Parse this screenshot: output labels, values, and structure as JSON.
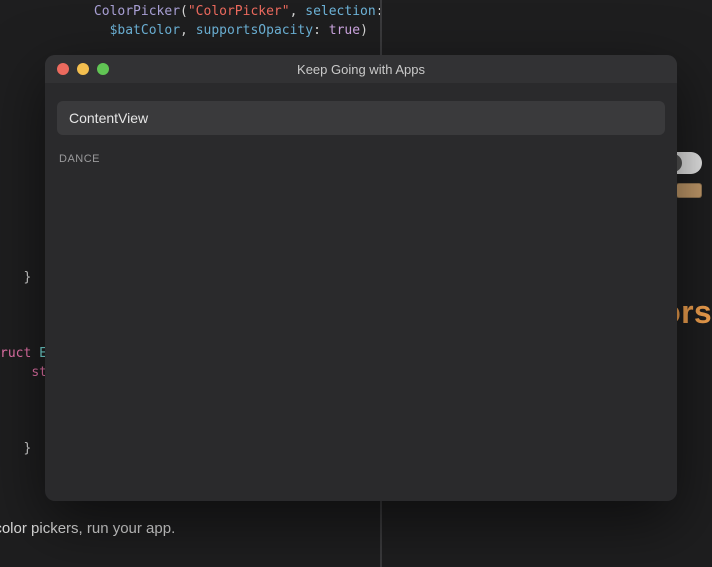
{
  "code": {
    "indent1": "            ",
    "fn": "ColorPicker",
    "open_paren": "(",
    "str": "\"ColorPicker\"",
    "after_str": ", ",
    "arg1_label": "selection",
    "colon1": ":",
    "indent2": "              ",
    "arg1_value": "$batColor",
    "after_val": ", ",
    "arg2_label": "supportsOpacity",
    "colon2": ": ",
    "arg2_value": "true",
    "close_paren": ")",
    "brace1_indent": "   ",
    "brace1": "}",
    "kw_struct": "ruct",
    "space1": " ",
    "type_name": "E",
    "indent3": "    ",
    "kw_static": "stat",
    "brace2_indent": "   ",
    "brace2": "}"
  },
  "rightPanel": {
    "partialWord": "ors"
  },
  "bottomText": "t color pickers, run your app.",
  "modal": {
    "title": "Keep Going with Apps",
    "searchValue": "ContentView",
    "sectionLabel": "DANCE"
  }
}
